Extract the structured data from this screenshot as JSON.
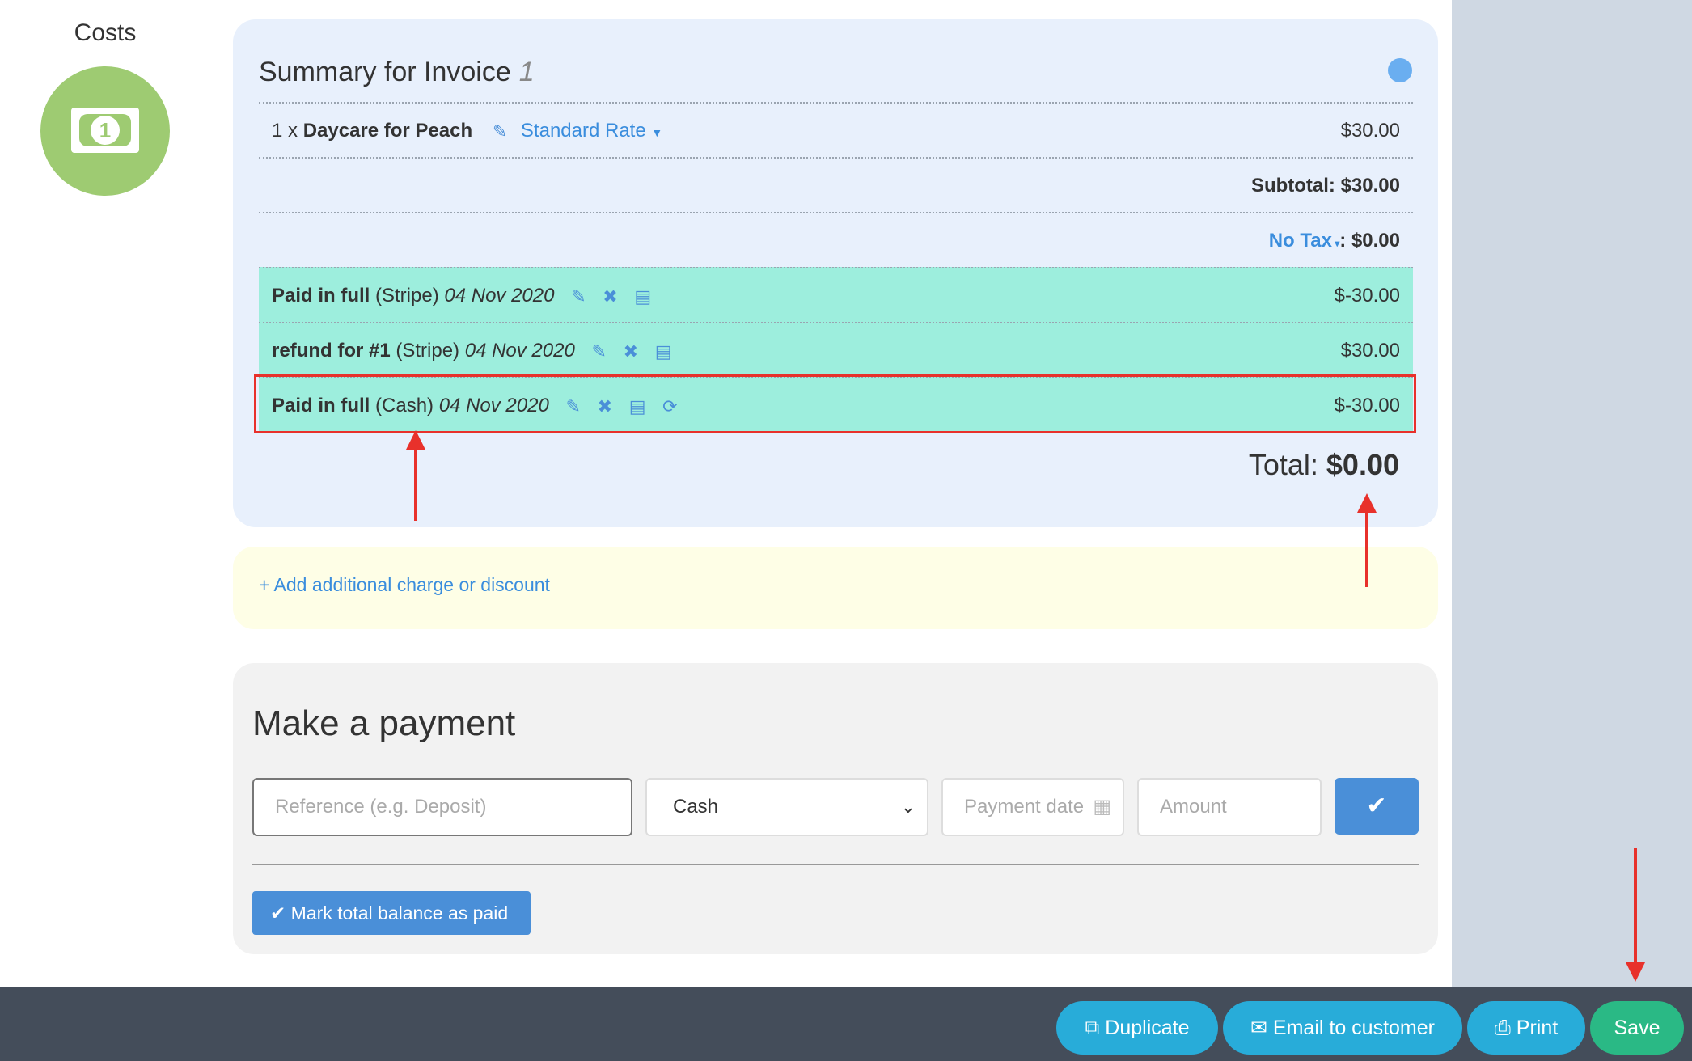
{
  "sidebar": {
    "label": "Costs",
    "icon": "money-bill-icon",
    "coin": "1"
  },
  "summary": {
    "title": "Summary for Invoice",
    "invoice_number": "1",
    "line_item": {
      "qty": "1 x",
      "name": "Daycare for Peach",
      "rate": "Standard Rate",
      "amount": "$30.00"
    },
    "subtotal": "Subtotal: $30.00",
    "tax_label": "No Tax",
    "tax_amount": ": $0.00",
    "payments": [
      {
        "label": "Paid in full",
        "method": "(Stripe)",
        "date": "04 Nov 2020",
        "amount": "$-30.00"
      },
      {
        "label": "refund for #1",
        "method": "(Stripe)",
        "date": "04 Nov 2020",
        "amount": "$30.00"
      },
      {
        "label": "Paid in full",
        "method": "(Cash)",
        "date": "04 Nov 2020",
        "amount": "$-30.00"
      }
    ],
    "total_label": "Total:",
    "total_value": "$0.00"
  },
  "add_charge": {
    "label": "+ Add additional charge or discount"
  },
  "payment": {
    "title": "Make a payment",
    "reference_placeholder": "Reference (e.g. Deposit)",
    "method_value": "Cash",
    "date_placeholder": "Payment date",
    "amount_placeholder": "Amount",
    "confirm_icon": "check-icon",
    "mark_paid_label": "Mark total balance as paid"
  },
  "footer": {
    "duplicate": "Duplicate",
    "email": "Email to customer",
    "print": "Print",
    "save": "Save"
  },
  "colors": {
    "accent": "#4a8fd8",
    "paid_row": "#9deedd",
    "save": "#2ab985",
    "footer_button": "#28acd9",
    "annotation": "#e8312b"
  }
}
